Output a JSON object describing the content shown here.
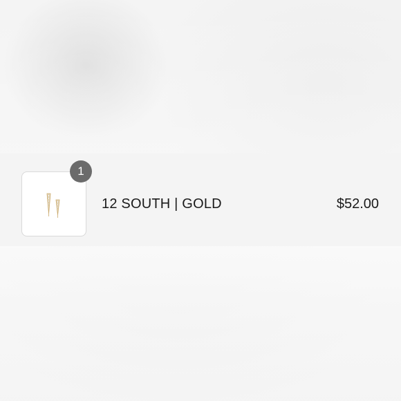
{
  "line_item": {
    "quantity": "1",
    "product_name": "12 SOUTH | GOLD",
    "price": "$52.00",
    "thumbnail_icon": "earring-product-image"
  },
  "colors": {
    "background": "#f4f4f4",
    "badge": "#6b6b6b",
    "text": "#1a1a1a",
    "thumbnail_border": "#d9d9d9"
  }
}
